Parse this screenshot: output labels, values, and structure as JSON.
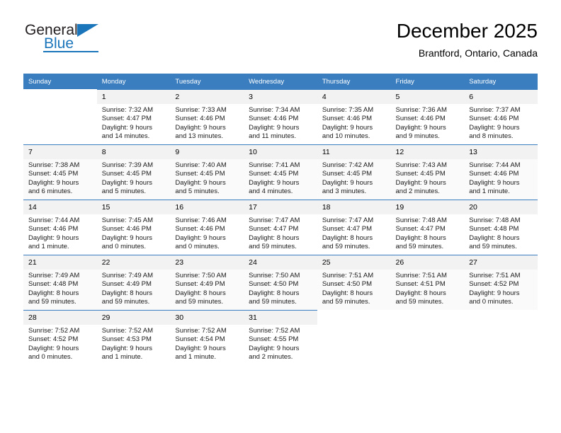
{
  "brand": {
    "name_top": "General",
    "name_bottom": "Blue",
    "accent_color": "#1b75bb"
  },
  "header": {
    "title": "December 2025",
    "subtitle": "Brantford, Ontario, Canada"
  },
  "calendar": {
    "header_bg": "#3a7ebf",
    "daynum_bg": "#f2f2f2",
    "weekdays": [
      "Sunday",
      "Monday",
      "Tuesday",
      "Wednesday",
      "Thursday",
      "Friday",
      "Saturday"
    ],
    "weeks": [
      [
        {
          "day": ""
        },
        {
          "day": "1",
          "sunrise": "Sunrise: 7:32 AM",
          "sunset": "Sunset: 4:47 PM",
          "daylight1": "Daylight: 9 hours",
          "daylight2": "and 14 minutes."
        },
        {
          "day": "2",
          "sunrise": "Sunrise: 7:33 AM",
          "sunset": "Sunset: 4:46 PM",
          "daylight1": "Daylight: 9 hours",
          "daylight2": "and 13 minutes."
        },
        {
          "day": "3",
          "sunrise": "Sunrise: 7:34 AM",
          "sunset": "Sunset: 4:46 PM",
          "daylight1": "Daylight: 9 hours",
          "daylight2": "and 11 minutes."
        },
        {
          "day": "4",
          "sunrise": "Sunrise: 7:35 AM",
          "sunset": "Sunset: 4:46 PM",
          "daylight1": "Daylight: 9 hours",
          "daylight2": "and 10 minutes."
        },
        {
          "day": "5",
          "sunrise": "Sunrise: 7:36 AM",
          "sunset": "Sunset: 4:46 PM",
          "daylight1": "Daylight: 9 hours",
          "daylight2": "and 9 minutes."
        },
        {
          "day": "6",
          "sunrise": "Sunrise: 7:37 AM",
          "sunset": "Sunset: 4:46 PM",
          "daylight1": "Daylight: 9 hours",
          "daylight2": "and 8 minutes."
        }
      ],
      [
        {
          "day": "7",
          "sunrise": "Sunrise: 7:38 AM",
          "sunset": "Sunset: 4:45 PM",
          "daylight1": "Daylight: 9 hours",
          "daylight2": "and 6 minutes."
        },
        {
          "day": "8",
          "sunrise": "Sunrise: 7:39 AM",
          "sunset": "Sunset: 4:45 PM",
          "daylight1": "Daylight: 9 hours",
          "daylight2": "and 5 minutes."
        },
        {
          "day": "9",
          "sunrise": "Sunrise: 7:40 AM",
          "sunset": "Sunset: 4:45 PM",
          "daylight1": "Daylight: 9 hours",
          "daylight2": "and 5 minutes."
        },
        {
          "day": "10",
          "sunrise": "Sunrise: 7:41 AM",
          "sunset": "Sunset: 4:45 PM",
          "daylight1": "Daylight: 9 hours",
          "daylight2": "and 4 minutes."
        },
        {
          "day": "11",
          "sunrise": "Sunrise: 7:42 AM",
          "sunset": "Sunset: 4:45 PM",
          "daylight1": "Daylight: 9 hours",
          "daylight2": "and 3 minutes."
        },
        {
          "day": "12",
          "sunrise": "Sunrise: 7:43 AM",
          "sunset": "Sunset: 4:45 PM",
          "daylight1": "Daylight: 9 hours",
          "daylight2": "and 2 minutes."
        },
        {
          "day": "13",
          "sunrise": "Sunrise: 7:44 AM",
          "sunset": "Sunset: 4:46 PM",
          "daylight1": "Daylight: 9 hours",
          "daylight2": "and 1 minute."
        }
      ],
      [
        {
          "day": "14",
          "sunrise": "Sunrise: 7:44 AM",
          "sunset": "Sunset: 4:46 PM",
          "daylight1": "Daylight: 9 hours",
          "daylight2": "and 1 minute."
        },
        {
          "day": "15",
          "sunrise": "Sunrise: 7:45 AM",
          "sunset": "Sunset: 4:46 PM",
          "daylight1": "Daylight: 9 hours",
          "daylight2": "and 0 minutes."
        },
        {
          "day": "16",
          "sunrise": "Sunrise: 7:46 AM",
          "sunset": "Sunset: 4:46 PM",
          "daylight1": "Daylight: 9 hours",
          "daylight2": "and 0 minutes."
        },
        {
          "day": "17",
          "sunrise": "Sunrise: 7:47 AM",
          "sunset": "Sunset: 4:47 PM",
          "daylight1": "Daylight: 8 hours",
          "daylight2": "and 59 minutes."
        },
        {
          "day": "18",
          "sunrise": "Sunrise: 7:47 AM",
          "sunset": "Sunset: 4:47 PM",
          "daylight1": "Daylight: 8 hours",
          "daylight2": "and 59 minutes."
        },
        {
          "day": "19",
          "sunrise": "Sunrise: 7:48 AM",
          "sunset": "Sunset: 4:47 PM",
          "daylight1": "Daylight: 8 hours",
          "daylight2": "and 59 minutes."
        },
        {
          "day": "20",
          "sunrise": "Sunrise: 7:48 AM",
          "sunset": "Sunset: 4:48 PM",
          "daylight1": "Daylight: 8 hours",
          "daylight2": "and 59 minutes."
        }
      ],
      [
        {
          "day": "21",
          "sunrise": "Sunrise: 7:49 AM",
          "sunset": "Sunset: 4:48 PM",
          "daylight1": "Daylight: 8 hours",
          "daylight2": "and 59 minutes."
        },
        {
          "day": "22",
          "sunrise": "Sunrise: 7:49 AM",
          "sunset": "Sunset: 4:49 PM",
          "daylight1": "Daylight: 8 hours",
          "daylight2": "and 59 minutes."
        },
        {
          "day": "23",
          "sunrise": "Sunrise: 7:50 AM",
          "sunset": "Sunset: 4:49 PM",
          "daylight1": "Daylight: 8 hours",
          "daylight2": "and 59 minutes."
        },
        {
          "day": "24",
          "sunrise": "Sunrise: 7:50 AM",
          "sunset": "Sunset: 4:50 PM",
          "daylight1": "Daylight: 8 hours",
          "daylight2": "and 59 minutes."
        },
        {
          "day": "25",
          "sunrise": "Sunrise: 7:51 AM",
          "sunset": "Sunset: 4:50 PM",
          "daylight1": "Daylight: 8 hours",
          "daylight2": "and 59 minutes."
        },
        {
          "day": "26",
          "sunrise": "Sunrise: 7:51 AM",
          "sunset": "Sunset: 4:51 PM",
          "daylight1": "Daylight: 8 hours",
          "daylight2": "and 59 minutes."
        },
        {
          "day": "27",
          "sunrise": "Sunrise: 7:51 AM",
          "sunset": "Sunset: 4:52 PM",
          "daylight1": "Daylight: 9 hours",
          "daylight2": "and 0 minutes."
        }
      ],
      [
        {
          "day": "28",
          "sunrise": "Sunrise: 7:52 AM",
          "sunset": "Sunset: 4:52 PM",
          "daylight1": "Daylight: 9 hours",
          "daylight2": "and 0 minutes."
        },
        {
          "day": "29",
          "sunrise": "Sunrise: 7:52 AM",
          "sunset": "Sunset: 4:53 PM",
          "daylight1": "Daylight: 9 hours",
          "daylight2": "and 1 minute."
        },
        {
          "day": "30",
          "sunrise": "Sunrise: 7:52 AM",
          "sunset": "Sunset: 4:54 PM",
          "daylight1": "Daylight: 9 hours",
          "daylight2": "and 1 minute."
        },
        {
          "day": "31",
          "sunrise": "Sunrise: 7:52 AM",
          "sunset": "Sunset: 4:55 PM",
          "daylight1": "Daylight: 9 hours",
          "daylight2": "and 2 minutes."
        },
        {
          "day": ""
        },
        {
          "day": ""
        },
        {
          "day": ""
        }
      ]
    ]
  }
}
